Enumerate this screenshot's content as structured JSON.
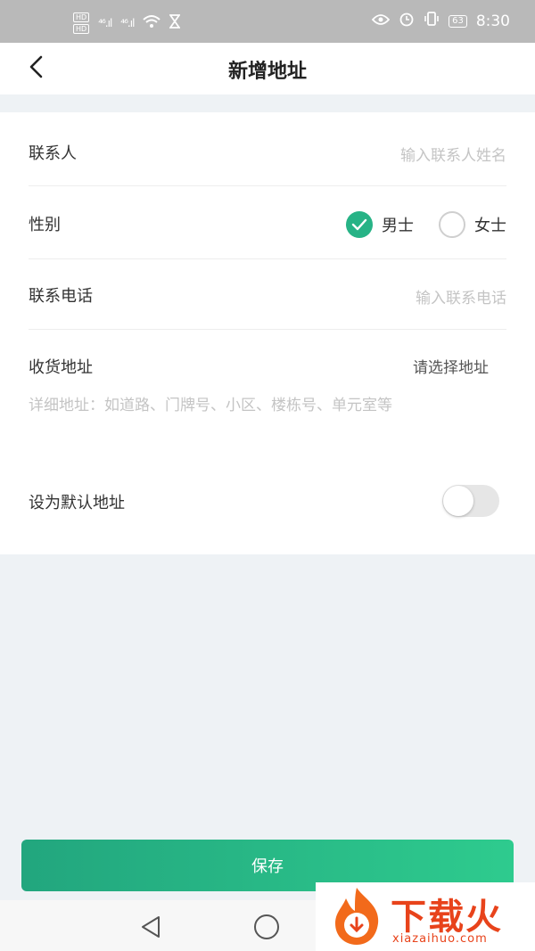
{
  "status_bar": {
    "hd_top": "HD",
    "hd_bottom": "HD",
    "signal1": "⁴⁶.ıl",
    "signal2": "⁴⁶.ıl",
    "battery": "63",
    "time": "8:30",
    "icons": [
      "eye-icon",
      "alarm-icon",
      "vibrate-icon",
      "wifi-icon",
      "hourglass-icon"
    ]
  },
  "header": {
    "title": "新增地址"
  },
  "form": {
    "contact": {
      "label": "联系人",
      "placeholder": "输入联系人姓名"
    },
    "gender": {
      "label": "性别",
      "options": [
        "男士",
        "女士"
      ],
      "selected": "男士"
    },
    "phone": {
      "label": "联系电话",
      "placeholder": "输入联系电话"
    },
    "address": {
      "label": "收货地址",
      "region_placeholder": "请选择地址",
      "detail_placeholder": "详细地址：如道路、门牌号、小区、楼栋号、单元室等"
    },
    "default": {
      "label": "设为默认地址",
      "enabled": false
    }
  },
  "footer": {
    "save_label": "保存"
  },
  "watermark": {
    "brand": "下载火",
    "url": "xiazaihuo.com"
  },
  "colors": {
    "accent": "#27b386",
    "watermark": "#e8431b"
  }
}
